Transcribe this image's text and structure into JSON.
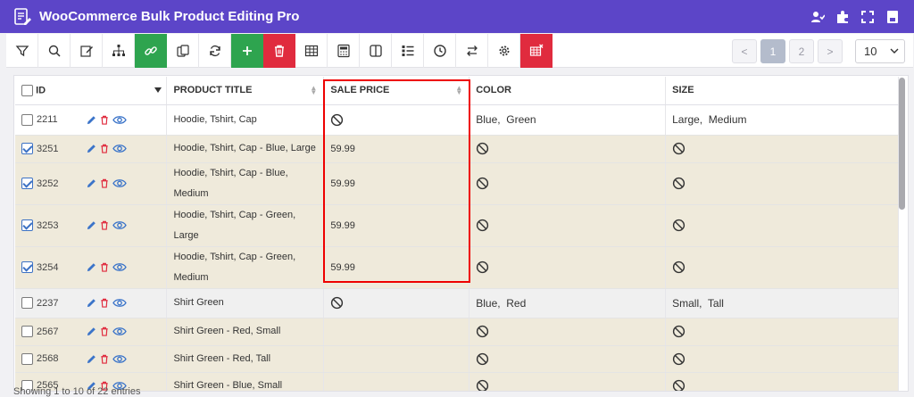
{
  "app": {
    "title": "WooCommerce Bulk Product Editing Pro"
  },
  "pagination": {
    "prev": "<",
    "pages": [
      "1",
      "2"
    ],
    "next": ">",
    "page_size": "10"
  },
  "columns": {
    "id": "ID",
    "title": "PRODUCT TITLE",
    "sale_price": "SALE PRICE",
    "color": "COLOR",
    "size": "SIZE"
  },
  "rows": [
    {
      "id": "2211",
      "checked": false,
      "title": [
        "Hoodie, Tshirt, Cap"
      ],
      "sale_price": "",
      "color": "Blue,  Green",
      "size": "Large,  Medium",
      "style": "plain"
    },
    {
      "id": "3251",
      "checked": true,
      "title": [
        "Hoodie, Tshirt, Cap - Blue, Large"
      ],
      "sale_price": "59.99",
      "color": "",
      "size": "",
      "style": "sel"
    },
    {
      "id": "3252",
      "checked": true,
      "title": [
        "Hoodie, Tshirt, Cap - Blue,",
        "Medium"
      ],
      "sale_price": "59.99",
      "color": "",
      "size": "",
      "style": "sel"
    },
    {
      "id": "3253",
      "checked": true,
      "title": [
        "Hoodie, Tshirt, Cap - Green,",
        "Large"
      ],
      "sale_price": "59.99",
      "color": "",
      "size": "",
      "style": "sel"
    },
    {
      "id": "3254",
      "checked": true,
      "title": [
        "Hoodie, Tshirt, Cap - Green,",
        "Medium"
      ],
      "sale_price": "59.99",
      "color": "",
      "size": "",
      "style": "sel"
    },
    {
      "id": "2237",
      "checked": false,
      "title": [
        "Shirt Green"
      ],
      "sale_price": "",
      "color": "Blue,  Red",
      "size": "Small,  Tall",
      "style": "grey"
    },
    {
      "id": "2567",
      "checked": false,
      "title": [
        "Shirt Green - Red, Small"
      ],
      "sale_price": "",
      "color": "",
      "size": "",
      "style": "sel"
    },
    {
      "id": "2568",
      "checked": false,
      "title": [
        "Shirt Green - Red, Tall"
      ],
      "sale_price": "",
      "color": "",
      "size": "",
      "style": "sel"
    },
    {
      "id": "2565",
      "checked": false,
      "title": [
        "Shirt Green - Blue, Small"
      ],
      "sale_price": "",
      "color": "",
      "size": "",
      "style": "sel"
    }
  ],
  "footer": {
    "text": "Showing 1 to 10 of 22 entries"
  },
  "colors": {
    "header": "#5c45c8",
    "green": "#2ea44f",
    "red": "#e02b3e",
    "row_selected": "#efeadb"
  }
}
